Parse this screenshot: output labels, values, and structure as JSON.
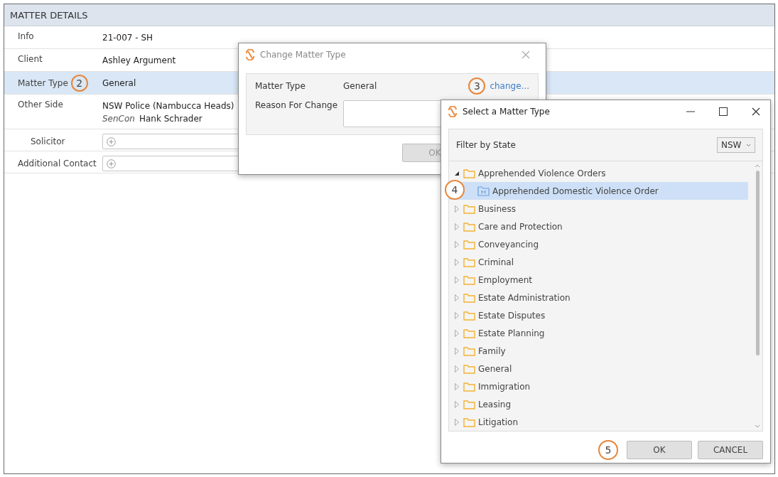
{
  "panel": {
    "title": "MATTER DETAILS",
    "rows": [
      {
        "kind": "text",
        "label": "Info",
        "value": "21-007 - SH",
        "selected": false
      },
      {
        "kind": "text",
        "label": "Client",
        "value": "Ashley Argument",
        "selected": false
      },
      {
        "kind": "text",
        "label": "Matter Type",
        "value": "General",
        "selected": true,
        "callout": "2"
      },
      {
        "kind": "contact",
        "label": "Other Side",
        "value": "NSW Police (Nambucca Heads)",
        "role": "SenCon",
        "contact": "Hank Schrader",
        "selected": false,
        "children": [
          {
            "kind": "add",
            "label": "Solicitor"
          }
        ]
      },
      {
        "kind": "add",
        "label": "Additional Contact"
      }
    ]
  },
  "change_dialog": {
    "title": "Change Matter Type",
    "matter_type_label": "Matter Type",
    "matter_type_value": "General",
    "callout": "3",
    "link": "change...",
    "reason_label": "Reason For Change",
    "buttons": [
      "OK"
    ]
  },
  "select_dialog": {
    "title": "Select a Matter Type",
    "filter_label": "Filter by State",
    "filter_value": "NSW",
    "tree": [
      {
        "label": "Apprehended Violence Orders",
        "expanded": true,
        "selected": false,
        "children": [
          {
            "label": "Apprehended Domestic Violence Order",
            "selected": true,
            "callout": "4"
          }
        ]
      },
      {
        "label": "Business",
        "expanded": false,
        "selected": false
      },
      {
        "label": "Care and Protection",
        "expanded": false,
        "selected": false
      },
      {
        "label": "Conveyancing",
        "expanded": false,
        "selected": false
      },
      {
        "label": "Criminal",
        "expanded": false,
        "selected": false
      },
      {
        "label": "Employment",
        "expanded": false,
        "selected": false
      },
      {
        "label": "Estate Administration",
        "expanded": false,
        "selected": false
      },
      {
        "label": "Estate Disputes",
        "expanded": false,
        "selected": false
      },
      {
        "label": "Estate Planning",
        "expanded": false,
        "selected": false
      },
      {
        "label": "Family",
        "expanded": false,
        "selected": false
      },
      {
        "label": "General",
        "expanded": false,
        "selected": false
      },
      {
        "label": "Immigration",
        "expanded": false,
        "selected": false
      },
      {
        "label": "Leasing",
        "expanded": false,
        "selected": false
      },
      {
        "label": "Litigation",
        "expanded": false,
        "selected": false
      }
    ],
    "callout": "5",
    "buttons": [
      "OK",
      "CANCEL"
    ]
  }
}
